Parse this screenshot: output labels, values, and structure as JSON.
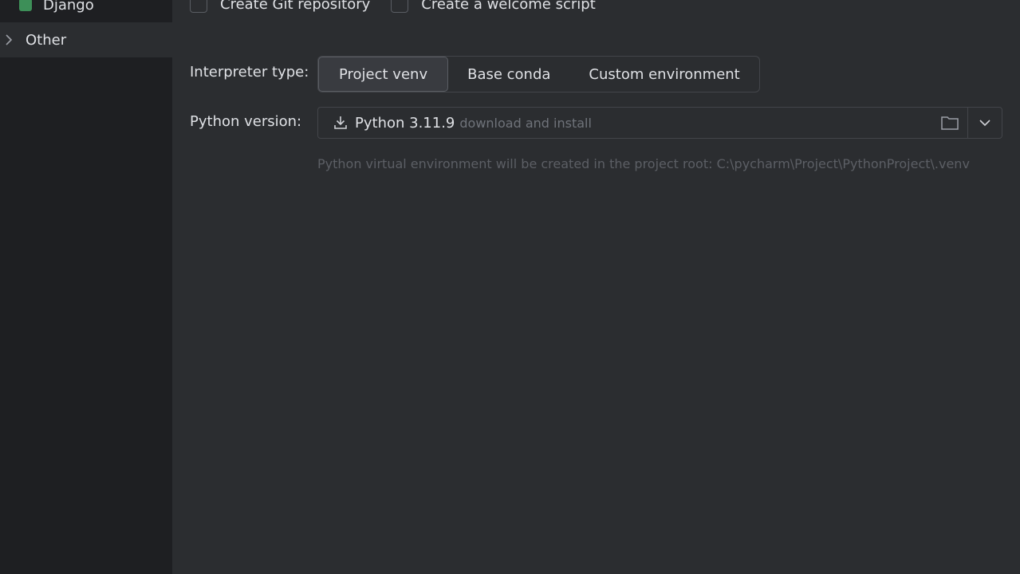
{
  "sidebar": {
    "items": [
      {
        "label": "Django"
      },
      {
        "label": "Other"
      }
    ]
  },
  "options": {
    "git_label": "Create Git repository",
    "welcome_label": "Create a welcome script"
  },
  "interpreter": {
    "label": "Interpreter type:",
    "types": [
      "Project venv",
      "Base conda",
      "Custom environment"
    ],
    "selected": "Project venv"
  },
  "python": {
    "label": "Python version:",
    "value": "Python 3.11.9",
    "hint": "download and install",
    "note": "Python virtual environment will be created in the project root: C:\\pycharm\\Project\\PythonProject\\.venv"
  },
  "colors": {
    "sidebar_bg": "#1e1f22",
    "main_bg": "#2b2d30",
    "django_icon": "#3d8f58"
  }
}
